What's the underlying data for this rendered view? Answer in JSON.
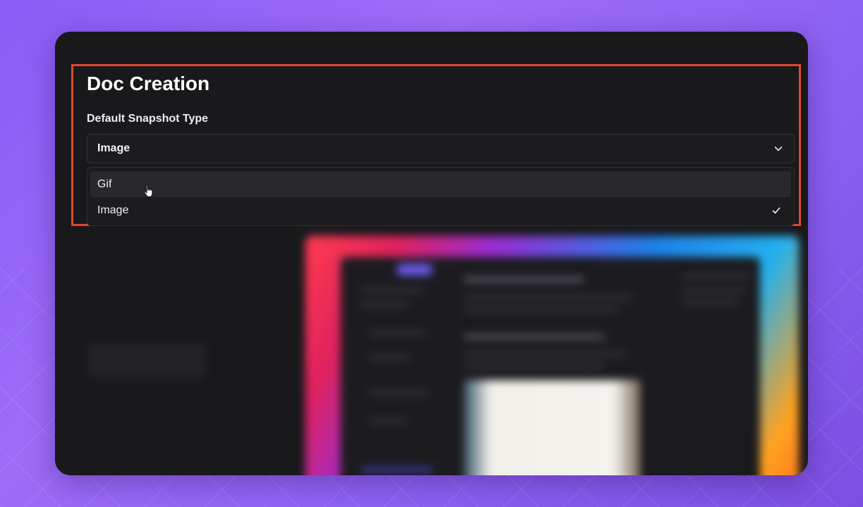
{
  "settings": {
    "section_title": "Doc Creation",
    "field_label": "Default Snapshot Type",
    "selected_value": "Image",
    "options": [
      {
        "label": "Gif",
        "selected": false,
        "hovered": true
      },
      {
        "label": "Image",
        "selected": true,
        "hovered": false
      }
    ]
  },
  "icons": {
    "dropdown": "chevron-down-icon",
    "selected": "checkmark-icon",
    "pointer": "hand-pointer-cursor"
  },
  "colors": {
    "page_background": "#8b5cf6",
    "window_background": "#19191c",
    "highlight_border": "#e2472c",
    "option_hover": "#28282d"
  }
}
